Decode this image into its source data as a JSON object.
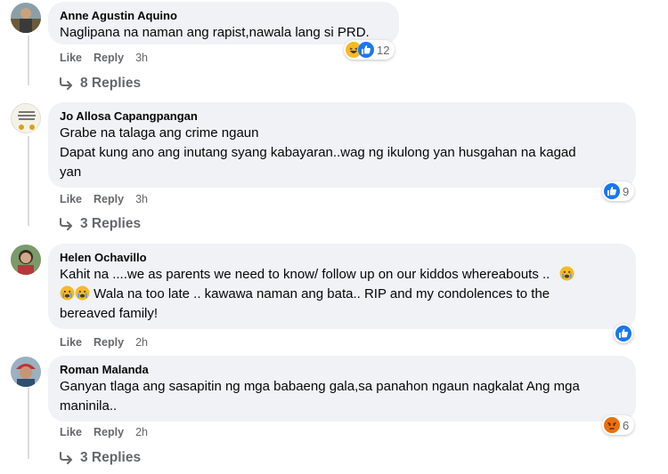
{
  "comments": [
    {
      "author": "Anne Agustin Aquino",
      "lines": [
        "Naglipana na naman ang rapist,nawala lang si PRD."
      ],
      "like": "Like",
      "reply": "Reply",
      "time": "3h",
      "reaction_count": "12",
      "reactions": [
        "haha",
        "like"
      ],
      "replies": "8 Replies"
    },
    {
      "author": "Jo Allosa Capangpangan",
      "lines": [
        "Grabe na talaga ang crime ngaun",
        "Dapat kung ano ang inutang syang kabayaran..wag ng ikulong yan husgahan na kagad",
        "yan"
      ],
      "like": "Like",
      "reply": "Reply",
      "time": "3h",
      "reaction_count": "9",
      "reactions": [
        "like"
      ],
      "replies": "3 Replies"
    },
    {
      "author": "Helen Ochavillo",
      "lines": [
        "Kahit na ....we as parents we need to know/ follow up on our kiddos whereabouts ..",
        "Wala na too late .. kawawa naman ang bata.. RIP and my condolences to the",
        "bereaved family!"
      ],
      "like": "Like",
      "reply": "Reply",
      "time": "2h",
      "reaction_count": "",
      "reactions": [
        "like"
      ],
      "replies": ""
    },
    {
      "author": "Roman Malanda",
      "lines": [
        "Ganyan tlaga ang sasapitin ng mga babaeng gala,sa panahon ngaun nagkalat Ang mga",
        "maninila.."
      ],
      "like": "Like",
      "reply": "Reply",
      "time": "2h",
      "reaction_count": "6",
      "reactions": [
        "angry"
      ],
      "replies": "3 Replies"
    }
  ],
  "colors": {
    "like_blue": "#1877f2",
    "haha_yellow": "#f7b928",
    "angry_red": "#e9710f",
    "meta_gray": "#65676b",
    "bubble_bg": "#f0f2f5"
  },
  "icons": [
    "reply-arrow-icon",
    "like-reaction-icon",
    "haha-reaction-icon",
    "angry-reaction-icon",
    "crying-emoji-icon"
  ]
}
